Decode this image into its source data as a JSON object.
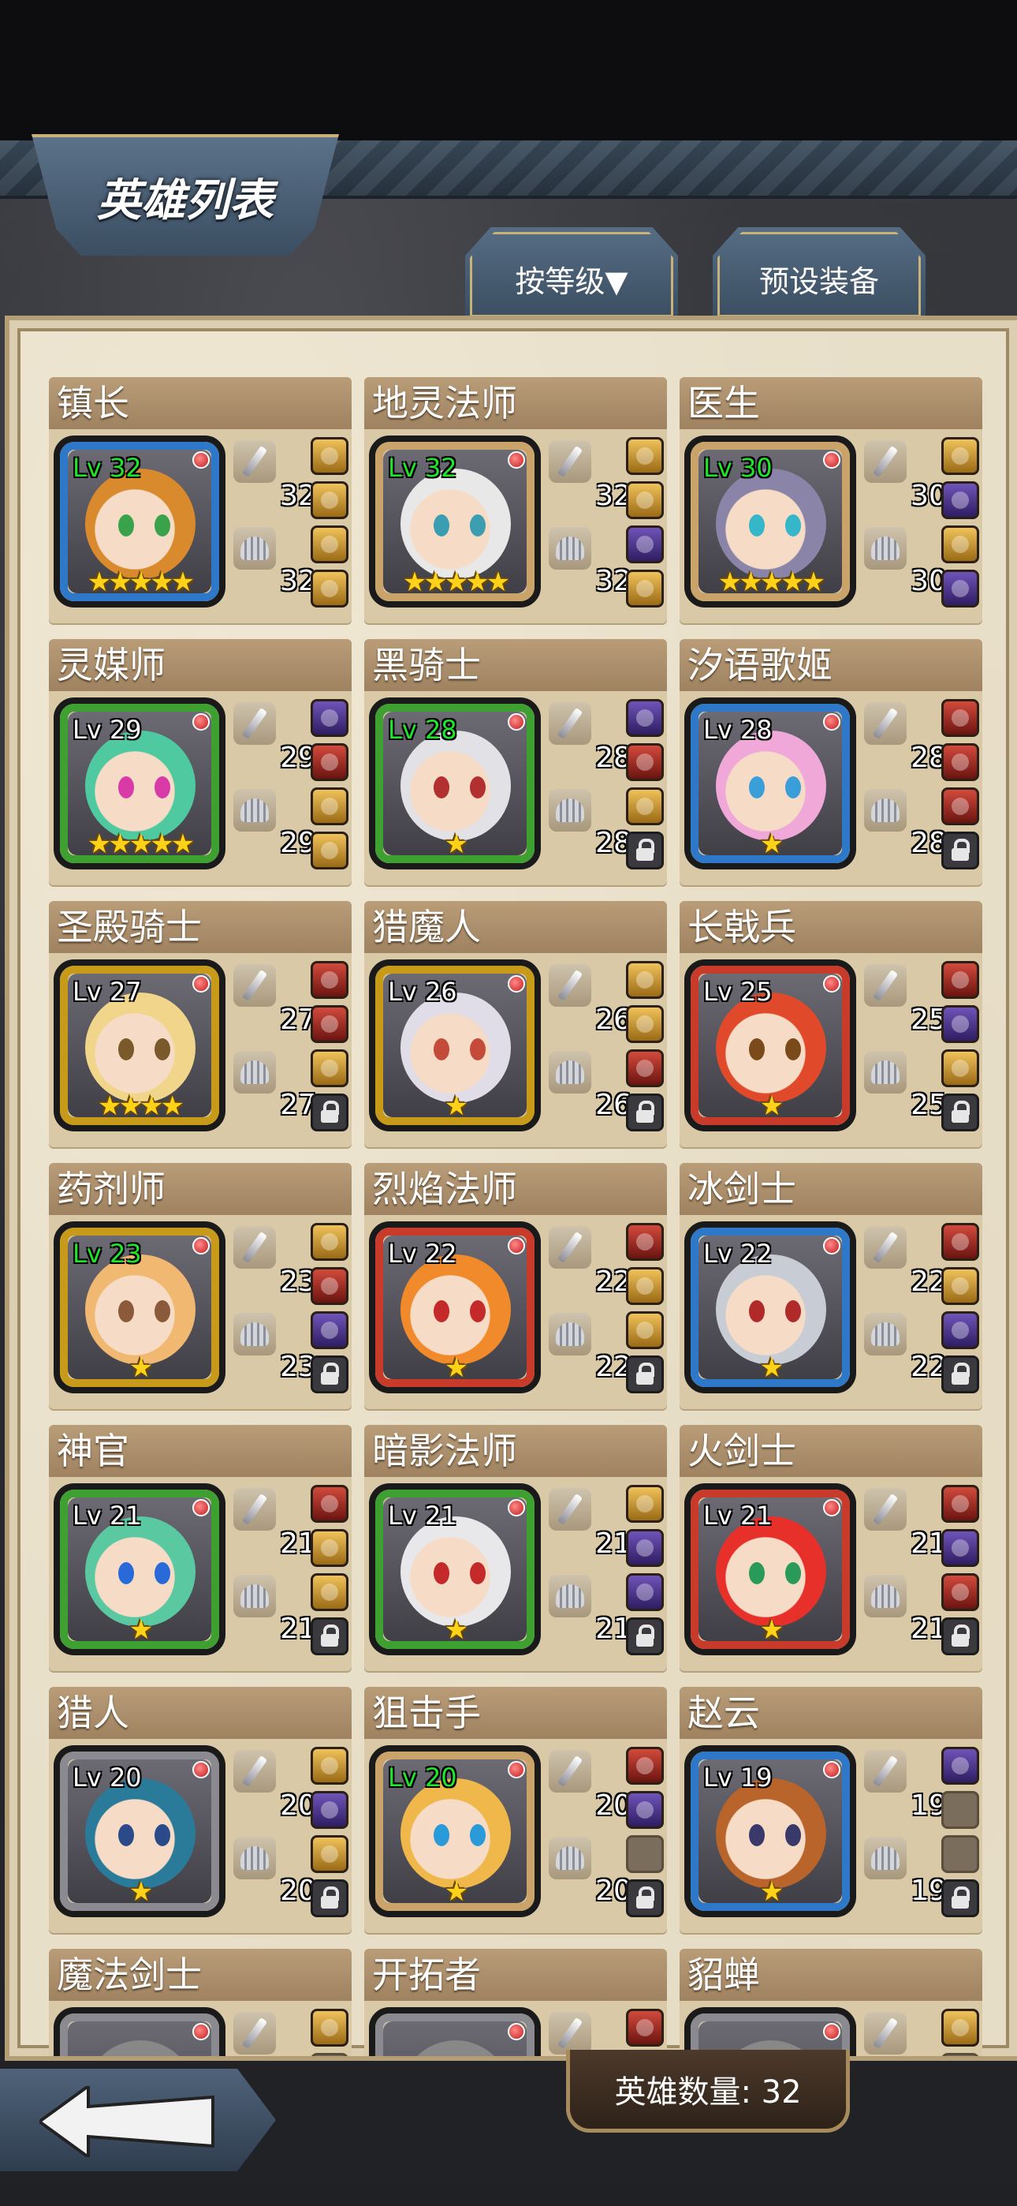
{
  "title": "英雄列表",
  "sort_button": "按等级▼",
  "preset_button": "预设装备",
  "hero_count_label": "英雄数量: 32",
  "heroes": [
    {
      "name": "镇长",
      "lv": "Lv 32",
      "atk": "32",
      "def": "32",
      "stars": "★★★★★",
      "lvColor": "green",
      "rarity": "#2d78c8",
      "hair": "#d98a2c",
      "eye": "#3aa24a",
      "equip": [
        "gold",
        "gold",
        "gold",
        "gold"
      ]
    },
    {
      "name": "地灵法师",
      "lv": "Lv 32",
      "atk": "32",
      "def": "32",
      "stars": "★★★★★",
      "lvColor": "green",
      "rarity": "#c9a36a",
      "hair": "#e8e8e8",
      "eye": "#3b9db0",
      "equip": [
        "gold",
        "gold",
        "purple",
        "gold"
      ]
    },
    {
      "name": "医生",
      "lv": "Lv 30",
      "atk": "30",
      "def": "30",
      "stars": "★★★★★",
      "lvColor": "green",
      "rarity": "#c9a36a",
      "hair": "#8a84a8",
      "eye": "#36b6c9",
      "equip": [
        "gold",
        "purple",
        "gold",
        "purple"
      ]
    },
    {
      "name": "灵媒师",
      "lv": "Lv 29",
      "atk": "29",
      "def": "29",
      "stars": "★★★★★",
      "lvColor": "white",
      "rarity": "#3fa032",
      "hair": "#4fc9a0",
      "eye": "#d83aa8",
      "equip": [
        "purple",
        "red",
        "gold",
        "gold"
      ]
    },
    {
      "name": "黑骑士",
      "lv": "Lv 28",
      "atk": "28",
      "def": "28",
      "stars": "★",
      "lvColor": "green",
      "rarity": "#3fa032",
      "hair": "#e2e2e6",
      "eye": "#b23030",
      "equip": [
        "purple",
        "red",
        "gold",
        "lock"
      ]
    },
    {
      "name": "汐语歌姬",
      "lv": "Lv 28",
      "atk": "28",
      "def": "28",
      "stars": "★",
      "lvColor": "white",
      "rarity": "#2d78c8",
      "hair": "#f0a8d8",
      "eye": "#3a9fd8",
      "equip": [
        "red",
        "red",
        "red",
        "lock"
      ]
    },
    {
      "name": "圣殿骑士",
      "lv": "Lv 27",
      "atk": "27",
      "def": "27",
      "stars": "★★★★",
      "lvColor": "white",
      "rarity": "#c79a1a",
      "hair": "#f0d58a",
      "eye": "#7a5a2a",
      "equip": [
        "red",
        "red",
        "gold",
        "lock"
      ]
    },
    {
      "name": "猎魔人",
      "lv": "Lv 26",
      "atk": "26",
      "def": "26",
      "stars": "★",
      "lvColor": "white",
      "rarity": "#c79a1a",
      "hair": "#e0dce8",
      "eye": "#c44a3a",
      "equip": [
        "gold",
        "gold",
        "red",
        "lock"
      ]
    },
    {
      "name": "长戟兵",
      "lv": "Lv 25",
      "atk": "25",
      "def": "25",
      "stars": "★",
      "lvColor": "white",
      "rarity": "#c83a2a",
      "hair": "#e04a2a",
      "eye": "#7a4a1a",
      "equip": [
        "red",
        "purple",
        "gold",
        "lock"
      ]
    },
    {
      "name": "药剂师",
      "lv": "Lv 23",
      "atk": "23",
      "def": "23",
      "stars": "★",
      "lvColor": "green",
      "rarity": "#c79a1a",
      "hair": "#f0b870",
      "eye": "#8a5a3a",
      "equip": [
        "gold",
        "red",
        "purple",
        "lock"
      ]
    },
    {
      "name": "烈焰法师",
      "lv": "Lv 22",
      "atk": "22",
      "def": "22",
      "stars": "★",
      "lvColor": "white",
      "rarity": "#c83a2a",
      "hair": "#f08a2a",
      "eye": "#c42a2a",
      "equip": [
        "red",
        "gold",
        "gold",
        "lock"
      ]
    },
    {
      "name": "冰剑士",
      "lv": "Lv 22",
      "atk": "22",
      "def": "22",
      "stars": "★",
      "lvColor": "white",
      "rarity": "#2d78c8",
      "hair": "#c8ccd4",
      "eye": "#b02a2a",
      "equip": [
        "red",
        "gold",
        "purple",
        "lock"
      ]
    },
    {
      "name": "神官",
      "lv": "Lv 21",
      "atk": "21",
      "def": "21",
      "stars": "★",
      "lvColor": "white",
      "rarity": "#3fa032",
      "hair": "#5ac8a0",
      "eye": "#2a6ad8",
      "equip": [
        "red",
        "gold",
        "gold",
        "lock"
      ]
    },
    {
      "name": "暗影法师",
      "lv": "Lv 21",
      "atk": "21",
      "def": "21",
      "stars": "★",
      "lvColor": "white",
      "rarity": "#3fa032",
      "hair": "#e8e8ea",
      "eye": "#c42a2a",
      "equip": [
        "gold",
        "purple",
        "purple",
        "lock"
      ]
    },
    {
      "name": "火剑士",
      "lv": "Lv 21",
      "atk": "21",
      "def": "21",
      "stars": "★",
      "lvColor": "white",
      "rarity": "#c83a2a",
      "hair": "#e8302a",
      "eye": "#2a9a5a",
      "equip": [
        "red",
        "purple",
        "red",
        "lock"
      ]
    },
    {
      "name": "猎人",
      "lv": "Lv 20",
      "atk": "20",
      "def": "20",
      "stars": "★",
      "lvColor": "white",
      "rarity": "#8a8a90",
      "hair": "#2a7a9a",
      "eye": "#2a4a8a",
      "equip": [
        "gold",
        "purple",
        "gold",
        "lock"
      ]
    },
    {
      "name": "狙击手",
      "lv": "Lv 20",
      "atk": "20",
      "def": "20",
      "stars": "★",
      "lvColor": "green",
      "rarity": "#c9a36a",
      "hair": "#f0b84a",
      "eye": "#2a9ad8",
      "equip": [
        "red",
        "purple",
        "empty",
        "lock"
      ]
    },
    {
      "name": "赵云",
      "lv": "Lv 19",
      "atk": "19",
      "def": "19",
      "stars": "★",
      "lvColor": "white",
      "rarity": "#2d78c8",
      "hair": "#b8642a",
      "eye": "#3a3a6a",
      "equip": [
        "purple",
        "empty",
        "empty",
        "lock"
      ]
    },
    {
      "name": "魔法剑士",
      "lv": "",
      "atk": "",
      "def": "",
      "stars": "",
      "lvColor": "white",
      "rarity": "#8a8a90",
      "hair": "#888",
      "eye": "#333",
      "equip": [
        "gold",
        "empty",
        "empty",
        "empty"
      ]
    },
    {
      "name": "开拓者",
      "lv": "",
      "atk": "",
      "def": "",
      "stars": "",
      "lvColor": "white",
      "rarity": "#8a8a90",
      "hair": "#888",
      "eye": "#333",
      "equip": [
        "red",
        "empty",
        "empty",
        "empty"
      ]
    },
    {
      "name": "貂蝉",
      "lv": "",
      "atk": "",
      "def": "",
      "stars": "",
      "lvColor": "white",
      "rarity": "#8a8a90",
      "hair": "#888",
      "eye": "#333",
      "equip": [
        "gold",
        "empty",
        "empty",
        "empty"
      ]
    }
  ]
}
